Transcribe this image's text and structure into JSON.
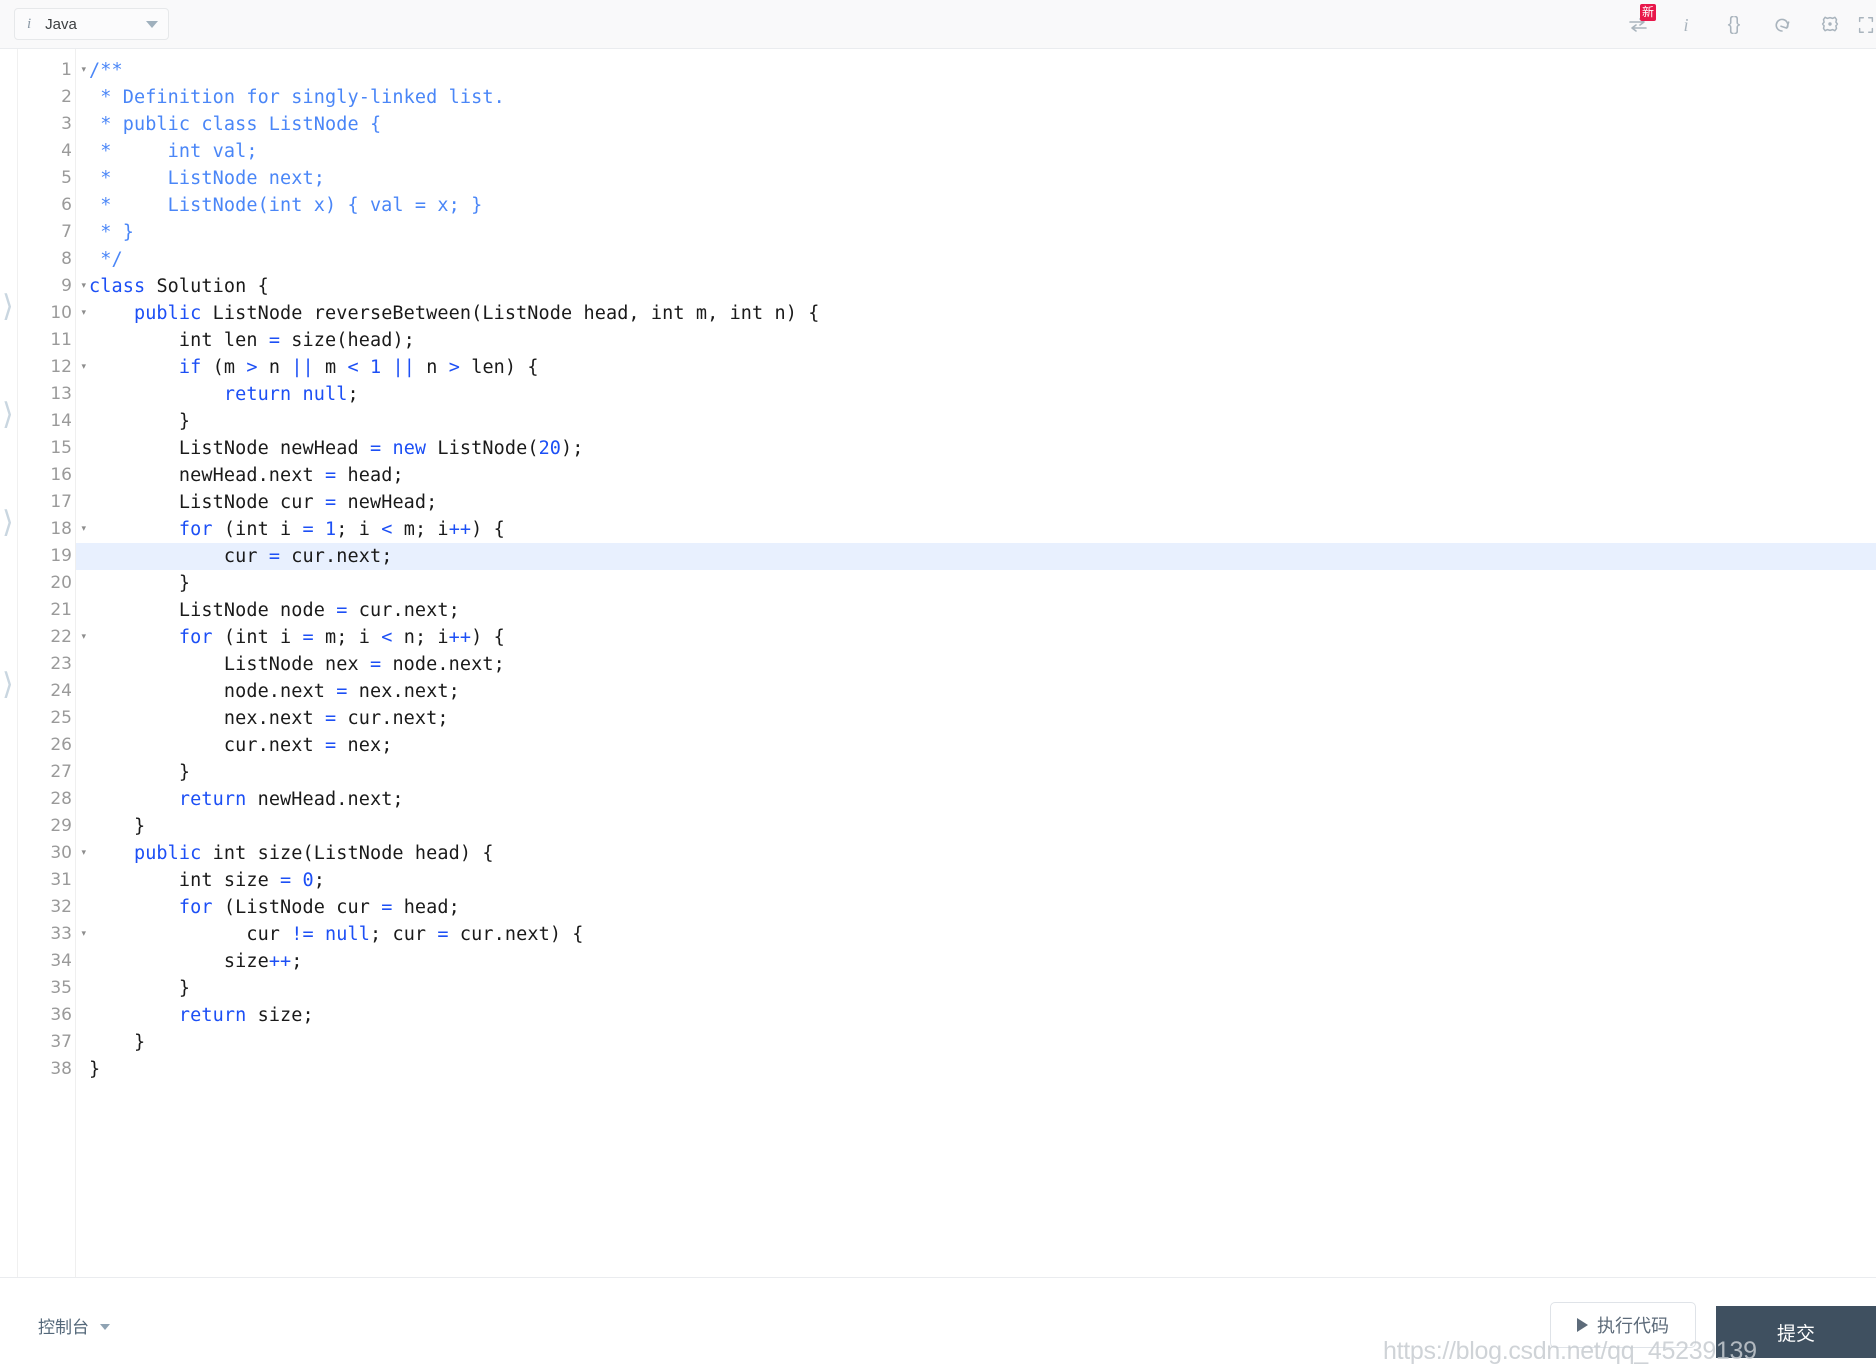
{
  "header": {
    "language_selector": {
      "icon": "info-italic-icon",
      "label": "Java",
      "caret": "chevron-down-icon"
    },
    "tools": [
      {
        "name": "swap-arrows-icon",
        "glyph": "⇌",
        "badge": "新"
      },
      {
        "name": "info-icon",
        "glyph": "i",
        "badge": ""
      },
      {
        "name": "curly-braces-icon",
        "glyph": "{}",
        "badge": ""
      },
      {
        "name": "undo-reset-icon",
        "glyph": "↺",
        "badge": ""
      },
      {
        "name": "settings-gear-icon",
        "glyph": "⚙",
        "badge": ""
      },
      {
        "name": "fullscreen-icon",
        "glyph": "↕",
        "badge": ""
      }
    ]
  },
  "editor": {
    "active_line": 19,
    "fold_lines": [
      1,
      9,
      10,
      12,
      18,
      22,
      30,
      33
    ],
    "fold_marker": "▾",
    "total_lines": 38,
    "lines": [
      {
        "n": 1,
        "tokens": [
          {
            "t": "/**",
            "c": "cmt"
          }
        ]
      },
      {
        "n": 2,
        "tokens": [
          {
            "t": " * Definition for singly-linked list.",
            "c": "cmt"
          }
        ]
      },
      {
        "n": 3,
        "tokens": [
          {
            "t": " * public class ListNode {",
            "c": "cmt"
          }
        ]
      },
      {
        "n": 4,
        "tokens": [
          {
            "t": " *     int val;",
            "c": "cmt"
          }
        ]
      },
      {
        "n": 5,
        "tokens": [
          {
            "t": " *     ListNode next;",
            "c": "cmt"
          }
        ]
      },
      {
        "n": 6,
        "tokens": [
          {
            "t": " *     ListNode(int x) { val = x; }",
            "c": "cmt"
          }
        ]
      },
      {
        "n": 7,
        "tokens": [
          {
            "t": " * }",
            "c": "cmt"
          }
        ]
      },
      {
        "n": 8,
        "tokens": [
          {
            "t": " */",
            "c": "cmt"
          }
        ]
      },
      {
        "n": 9,
        "tokens": [
          {
            "t": "class",
            "c": "kw"
          },
          {
            "t": " Solution {",
            "c": ""
          }
        ]
      },
      {
        "n": 10,
        "tokens": [
          {
            "t": "    ",
            "c": ""
          },
          {
            "t": "public",
            "c": "kw"
          },
          {
            "t": " ListNode reverseBetween(ListNode head, int m, int n) {",
            "c": ""
          }
        ]
      },
      {
        "n": 11,
        "tokens": [
          {
            "t": "        int len ",
            "c": ""
          },
          {
            "t": "=",
            "c": "op"
          },
          {
            "t": " size(head);",
            "c": ""
          }
        ]
      },
      {
        "n": 12,
        "tokens": [
          {
            "t": "        ",
            "c": ""
          },
          {
            "t": "if",
            "c": "kw"
          },
          {
            "t": " (m ",
            "c": ""
          },
          {
            "t": ">",
            "c": "op"
          },
          {
            "t": " n ",
            "c": ""
          },
          {
            "t": "||",
            "c": "op"
          },
          {
            "t": " m ",
            "c": ""
          },
          {
            "t": "<",
            "c": "op"
          },
          {
            "t": " ",
            "c": ""
          },
          {
            "t": "1",
            "c": "num"
          },
          {
            "t": " ",
            "c": ""
          },
          {
            "t": "||",
            "c": "op"
          },
          {
            "t": " n ",
            "c": ""
          },
          {
            "t": ">",
            "c": "op"
          },
          {
            "t": " len) {",
            "c": ""
          }
        ]
      },
      {
        "n": 13,
        "tokens": [
          {
            "t": "            ",
            "c": ""
          },
          {
            "t": "return",
            "c": "kw"
          },
          {
            "t": " ",
            "c": ""
          },
          {
            "t": "null",
            "c": "kw"
          },
          {
            "t": ";",
            "c": ""
          }
        ]
      },
      {
        "n": 14,
        "tokens": [
          {
            "t": "        }",
            "c": ""
          }
        ]
      },
      {
        "n": 15,
        "tokens": [
          {
            "t": "        ListNode newHead ",
            "c": ""
          },
          {
            "t": "=",
            "c": "op"
          },
          {
            "t": " ",
            "c": ""
          },
          {
            "t": "new",
            "c": "kw"
          },
          {
            "t": " ListNode(",
            "c": ""
          },
          {
            "t": "20",
            "c": "num"
          },
          {
            "t": ");",
            "c": ""
          }
        ]
      },
      {
        "n": 16,
        "tokens": [
          {
            "t": "        newHead.next ",
            "c": ""
          },
          {
            "t": "=",
            "c": "op"
          },
          {
            "t": " head;",
            "c": ""
          }
        ]
      },
      {
        "n": 17,
        "tokens": [
          {
            "t": "        ListNode cur ",
            "c": ""
          },
          {
            "t": "=",
            "c": "op"
          },
          {
            "t": " newHead;",
            "c": ""
          }
        ]
      },
      {
        "n": 18,
        "tokens": [
          {
            "t": "        ",
            "c": ""
          },
          {
            "t": "for",
            "c": "kw"
          },
          {
            "t": " (int i ",
            "c": ""
          },
          {
            "t": "=",
            "c": "op"
          },
          {
            "t": " ",
            "c": ""
          },
          {
            "t": "1",
            "c": "num"
          },
          {
            "t": "; i ",
            "c": ""
          },
          {
            "t": "<",
            "c": "op"
          },
          {
            "t": " m; i",
            "c": ""
          },
          {
            "t": "++",
            "c": "op"
          },
          {
            "t": ") {",
            "c": ""
          }
        ]
      },
      {
        "n": 19,
        "tokens": [
          {
            "t": "            cur ",
            "c": ""
          },
          {
            "t": "=",
            "c": "op"
          },
          {
            "t": " cur.next;",
            "c": ""
          }
        ]
      },
      {
        "n": 20,
        "tokens": [
          {
            "t": "        }",
            "c": ""
          }
        ]
      },
      {
        "n": 21,
        "tokens": [
          {
            "t": "        ListNode node ",
            "c": ""
          },
          {
            "t": "=",
            "c": "op"
          },
          {
            "t": " cur.next;",
            "c": ""
          }
        ]
      },
      {
        "n": 22,
        "tokens": [
          {
            "t": "        ",
            "c": ""
          },
          {
            "t": "for",
            "c": "kw"
          },
          {
            "t": " (int i ",
            "c": ""
          },
          {
            "t": "=",
            "c": "op"
          },
          {
            "t": " m; i ",
            "c": ""
          },
          {
            "t": "<",
            "c": "op"
          },
          {
            "t": " n; i",
            "c": ""
          },
          {
            "t": "++",
            "c": "op"
          },
          {
            "t": ") {",
            "c": ""
          }
        ]
      },
      {
        "n": 23,
        "tokens": [
          {
            "t": "            ListNode nex ",
            "c": ""
          },
          {
            "t": "=",
            "c": "op"
          },
          {
            "t": " node.next;",
            "c": ""
          }
        ]
      },
      {
        "n": 24,
        "tokens": [
          {
            "t": "            node.next ",
            "c": ""
          },
          {
            "t": "=",
            "c": "op"
          },
          {
            "t": " nex.next;",
            "c": ""
          }
        ]
      },
      {
        "n": 25,
        "tokens": [
          {
            "t": "            nex.next ",
            "c": ""
          },
          {
            "t": "=",
            "c": "op"
          },
          {
            "t": " cur.next;",
            "c": ""
          }
        ]
      },
      {
        "n": 26,
        "tokens": [
          {
            "t": "            cur.next ",
            "c": ""
          },
          {
            "t": "=",
            "c": "op"
          },
          {
            "t": " nex;",
            "c": ""
          }
        ]
      },
      {
        "n": 27,
        "tokens": [
          {
            "t": "        }",
            "c": ""
          }
        ]
      },
      {
        "n": 28,
        "tokens": [
          {
            "t": "        ",
            "c": ""
          },
          {
            "t": "return",
            "c": "kw"
          },
          {
            "t": " newHead.next;",
            "c": ""
          }
        ]
      },
      {
        "n": 29,
        "tokens": [
          {
            "t": "    }",
            "c": ""
          }
        ]
      },
      {
        "n": 30,
        "tokens": [
          {
            "t": "    ",
            "c": ""
          },
          {
            "t": "public",
            "c": "kw"
          },
          {
            "t": " int size(ListNode head) {",
            "c": ""
          }
        ]
      },
      {
        "n": 31,
        "tokens": [
          {
            "t": "        int size ",
            "c": ""
          },
          {
            "t": "=",
            "c": "op"
          },
          {
            "t": " ",
            "c": ""
          },
          {
            "t": "0",
            "c": "num"
          },
          {
            "t": ";",
            "c": ""
          }
        ]
      },
      {
        "n": 32,
        "tokens": [
          {
            "t": "        ",
            "c": ""
          },
          {
            "t": "for",
            "c": "kw"
          },
          {
            "t": " (ListNode cur ",
            "c": ""
          },
          {
            "t": "=",
            "c": "op"
          },
          {
            "t": " head;",
            "c": ""
          }
        ]
      },
      {
        "n": 33,
        "tokens": [
          {
            "t": "              cur ",
            "c": ""
          },
          {
            "t": "!=",
            "c": "op"
          },
          {
            "t": " ",
            "c": ""
          },
          {
            "t": "null",
            "c": "kw"
          },
          {
            "t": "; cur ",
            "c": ""
          },
          {
            "t": "=",
            "c": "op"
          },
          {
            "t": " cur.next) {",
            "c": ""
          }
        ]
      },
      {
        "n": 34,
        "tokens": [
          {
            "t": "            size",
            "c": ""
          },
          {
            "t": "++",
            "c": "op"
          },
          {
            "t": ";",
            "c": ""
          }
        ]
      },
      {
        "n": 35,
        "tokens": [
          {
            "t": "        }",
            "c": ""
          }
        ]
      },
      {
        "n": 36,
        "tokens": [
          {
            "t": "        ",
            "c": ""
          },
          {
            "t": "return",
            "c": "kw"
          },
          {
            "t": " size;",
            "c": ""
          }
        ]
      },
      {
        "n": 37,
        "tokens": [
          {
            "t": "    }",
            "c": ""
          }
        ]
      },
      {
        "n": 38,
        "tokens": [
          {
            "t": "}",
            "c": ""
          }
        ]
      }
    ],
    "brace_rail_lines": [
      10,
      14,
      18,
      24
    ]
  },
  "footer": {
    "console_label": "控制台",
    "run_label": "执行代码",
    "submit_label": "提交"
  },
  "watermark": "https://blog.csdn.net/qq_45239139",
  "colors": {
    "keyword": "#1c4ff5",
    "comment": "#4a86f7",
    "active_line": "#e8f0fe",
    "submit_bg": "#3f5060",
    "badge_red": "#e8174a"
  }
}
